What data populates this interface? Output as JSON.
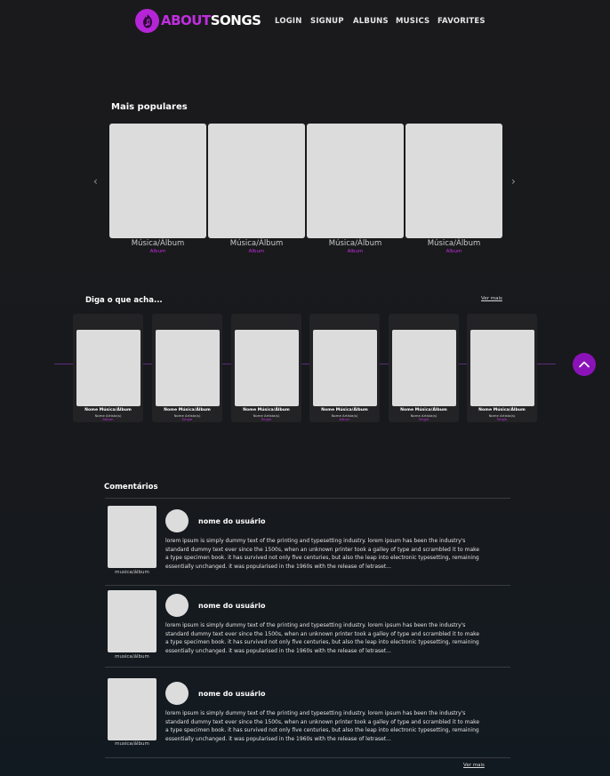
{
  "header": {
    "logo": {
      "part1": "ABOUT",
      "part2": "SONGS",
      "icon": "fire-music-logo-icon"
    },
    "nav": [
      {
        "label": "LOGIN"
      },
      {
        "label": "SIGNUP"
      },
      {
        "label": "ALBUNS"
      },
      {
        "label": "MUSICS"
      },
      {
        "label": "FAVORITES"
      }
    ]
  },
  "popular": {
    "title": "Mais populares",
    "items": [
      {
        "name": "Música/Álbum",
        "type": "Album"
      },
      {
        "name": "Música/Álbum",
        "type": "Album"
      },
      {
        "name": "Música/Álbum",
        "type": "Album"
      },
      {
        "name": "Música/Álbum",
        "type": "Album"
      }
    ]
  },
  "feedback": {
    "title": "Diga o que acha...",
    "see_more": "Ver mais",
    "items": [
      {
        "name": "Nome Música/Álbum",
        "artist": "Nome Artista(s)",
        "type": "Album"
      },
      {
        "name": "Nome Música/Álbum",
        "artist": "Nome Artista(s)",
        "type": "Single"
      },
      {
        "name": "Nome Música/Álbum",
        "artist": "Nome Artista(s)",
        "type": "Single"
      },
      {
        "name": "Nome Música/Álbum",
        "artist": "Nome Artista(s)",
        "type": "Album"
      },
      {
        "name": "Nome Música/Álbum",
        "artist": "Nome Artista(s)",
        "type": "Single"
      },
      {
        "name": "Nome Música/Álbum",
        "artist": "Nome Artista(s)",
        "type": "Single"
      }
    ]
  },
  "comments": {
    "title": "Comentários",
    "see_more": "Ver mais",
    "items": [
      {
        "image_label": "musica/álbum",
        "user": "nome do usuário",
        "lines": [
          "lorem ipsum is simply dummy text of the printing and typesetting industry. lorem ipsum has been the industry's",
          "standard dummy text ever since the 1500s, when an unknown printer took a galley of type and scrambled it to make",
          "a type specimen book. it has survived not only five centuries, but also the leap into electronic typesetting, remaining",
          "essentially unchanged. it was popularised in the 1960s with the release of letraset..."
        ]
      },
      {
        "image_label": "musica/álbum",
        "user": "nome do usuário",
        "lines": [
          "lorem ipsum is simply dummy text of the printing and typesetting industry. lorem ipsum has been the industry's",
          "standard dummy text ever since the 1500s, when an unknown printer took a galley of type and scrambled it to make",
          "a type specimen book. it has survived not only five centuries, but also the leap into electronic typesetting, remaining",
          "essentially unchanged. it was popularised in the 1960s with the release of letraset..."
        ]
      },
      {
        "image_label": "musica/álbum",
        "user": "nome do usuário",
        "lines": [
          "lorem ipsum is simply dummy text of the printing and typesetting industry. lorem ipsum has been the industry's",
          "standard dummy text ever since the 1500s, when an unknown printer took a galley of type and scrambled it to make",
          "a type specimen book. it has survived not only five centuries, but also the leap into electronic typesetting, remaining",
          "essentially unchanged. it was popularised in the 1960s with the release of letraset..."
        ]
      }
    ]
  },
  "colors": {
    "accent": "#c12ee0",
    "scroll_button": "#8a12b8",
    "card": "#dcdcdc"
  }
}
